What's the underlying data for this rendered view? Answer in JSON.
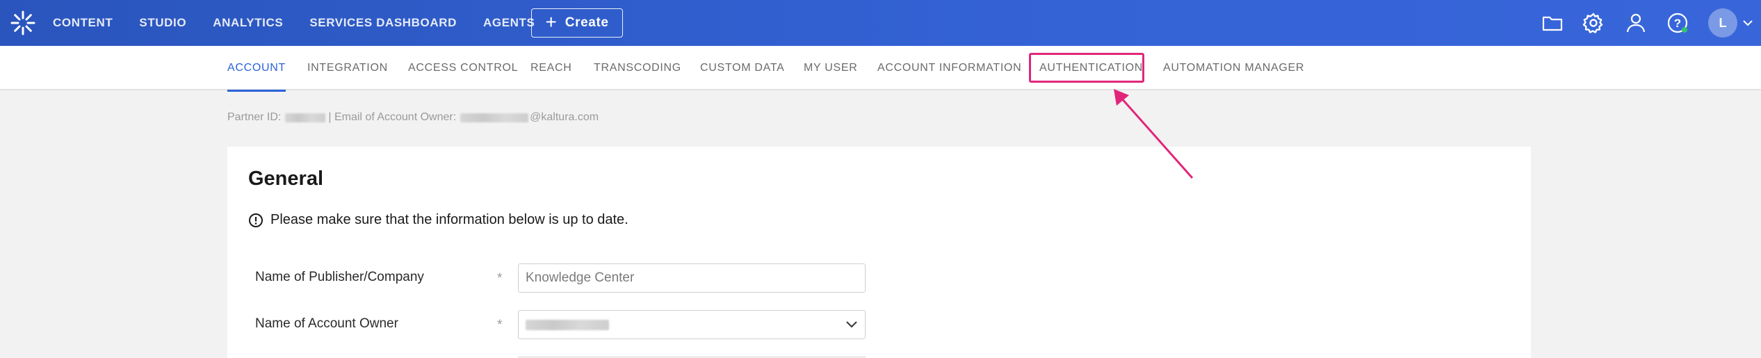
{
  "topnav": {
    "items": [
      "CONTENT",
      "STUDIO",
      "ANALYTICS",
      "SERVICES DASHBOARD",
      "AGENTS"
    ],
    "create_label": "Create"
  },
  "top_icons": [
    "folder-icon",
    "gear-icon",
    "user-icon",
    "help-icon"
  ],
  "avatar": {
    "initial": "L"
  },
  "tabs": [
    {
      "label": "ACCOUNT",
      "active": true
    },
    {
      "label": "INTEGRATION"
    },
    {
      "label": "ACCESS CONTROL"
    },
    {
      "label": "REACH"
    },
    {
      "label": "TRANSCODING"
    },
    {
      "label": "CUSTOM DATA"
    },
    {
      "label": "MY USER"
    },
    {
      "label": "ACCOUNT INFORMATION"
    },
    {
      "label": "AUTHENTICATION",
      "highlighted": true
    },
    {
      "label": "AUTOMATION MANAGER"
    }
  ],
  "partner": {
    "partner_id_label": "Partner ID:",
    "separator": "| Email of Account Owner:",
    "email_suffix": "@kaltura.com"
  },
  "general": {
    "title": "General",
    "notice": "Please make sure that the information below is up to date.",
    "fields": [
      {
        "label": "Name of Publisher/Company",
        "required_mark": "*",
        "value": "Knowledge Center"
      },
      {
        "label": "Name of Account Owner",
        "required_mark": "*",
        "value": ""
      }
    ]
  },
  "colors": {
    "brand": "#2a55bd",
    "active_tab": "#2b63d9",
    "highlight": "#e1267a",
    "status_online": "#35c46a"
  }
}
